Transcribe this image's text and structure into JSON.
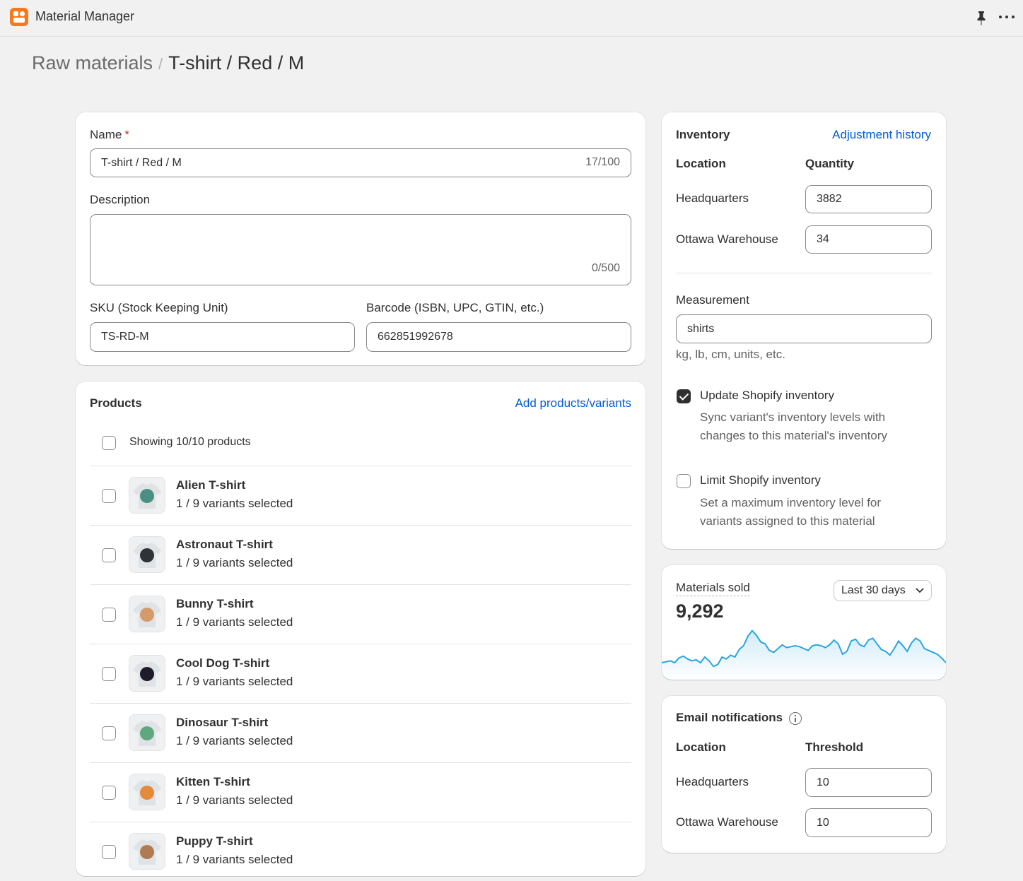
{
  "app": {
    "title": "Material Manager"
  },
  "breadcrumb": {
    "parent": "Raw materials",
    "separator": "/",
    "current": "T-shirt / Red / M"
  },
  "details": {
    "name_label": "Name",
    "name_required": "*",
    "name_value": "T-shirt / Red / M",
    "name_count": "17/100",
    "description_label": "Description",
    "description_value": "",
    "description_count": "0/500",
    "sku_label": "SKU (Stock Keeping Unit)",
    "sku_value": "TS-RD-M",
    "barcode_label": "Barcode (ISBN, UPC, GTIN, etc.)",
    "barcode_value": "662851992678"
  },
  "products": {
    "title": "Products",
    "add_link": "Add products/variants",
    "showing": "Showing 10/10 products",
    "items": [
      {
        "name": "Alien T-shirt",
        "variants": "1 / 9 variants selected",
        "color": "#4a8f86"
      },
      {
        "name": "Astronaut T-shirt",
        "variants": "1 / 9 variants selected",
        "color": "#2f3338"
      },
      {
        "name": "Bunny T-shirt",
        "variants": "1 / 9 variants selected",
        "color": "#d49a6a"
      },
      {
        "name": "Cool Dog T-shirt",
        "variants": "1 / 9 variants selected",
        "color": "#1f1b2b"
      },
      {
        "name": "Dinosaur T-shirt",
        "variants": "1 / 9 variants selected",
        "color": "#5fa77f"
      },
      {
        "name": "Kitten T-shirt",
        "variants": "1 / 9 variants selected",
        "color": "#e58a3a"
      },
      {
        "name": "Puppy T-shirt",
        "variants": "1 / 9 variants selected",
        "color": "#b07b52"
      }
    ]
  },
  "inventory": {
    "title": "Inventory",
    "history_link": "Adjustment history",
    "col_location": "Location",
    "col_quantity": "Quantity",
    "rows": [
      {
        "location": "Headquarters",
        "quantity": "3882"
      },
      {
        "location": "Ottawa Warehouse",
        "quantity": "34"
      }
    ],
    "measurement_label": "Measurement",
    "measurement_value": "shirts",
    "measurement_help": "kg, lb, cm, units, etc.",
    "update_label": "Update Shopify inventory",
    "update_checked": true,
    "update_help_1": "Sync variant's inventory levels with",
    "update_help_2": "changes to this material's inventory",
    "limit_label": "Limit Shopify inventory",
    "limit_checked": false,
    "limit_help_1": "Set a maximum inventory level for",
    "limit_help_2": "variants assigned to this material"
  },
  "sold": {
    "title": "Materials sold",
    "range": "Last 30 days",
    "total": "9,292",
    "accent": "#2ba4de",
    "chart_data": {
      "type": "area",
      "values": [
        18,
        19,
        20,
        18,
        23,
        25,
        22,
        20,
        21,
        18,
        24,
        20,
        14,
        16,
        24,
        22,
        26,
        24,
        32,
        36,
        46,
        52,
        47,
        40,
        38,
        31,
        29,
        33,
        37,
        34,
        35,
        36,
        35,
        33,
        31,
        36,
        37,
        36,
        34,
        37,
        42,
        38,
        27,
        30,
        41,
        43,
        37,
        35,
        42,
        44,
        38,
        32,
        30,
        26,
        33,
        41,
        36,
        30,
        39,
        44,
        41,
        33,
        31,
        29,
        27,
        23,
        18
      ]
    }
  },
  "email": {
    "title": "Email notifications",
    "col_location": "Location",
    "col_threshold": "Threshold",
    "rows": [
      {
        "location": "Headquarters",
        "threshold": "10"
      },
      {
        "location": "Ottawa Warehouse",
        "threshold": "10"
      }
    ]
  }
}
